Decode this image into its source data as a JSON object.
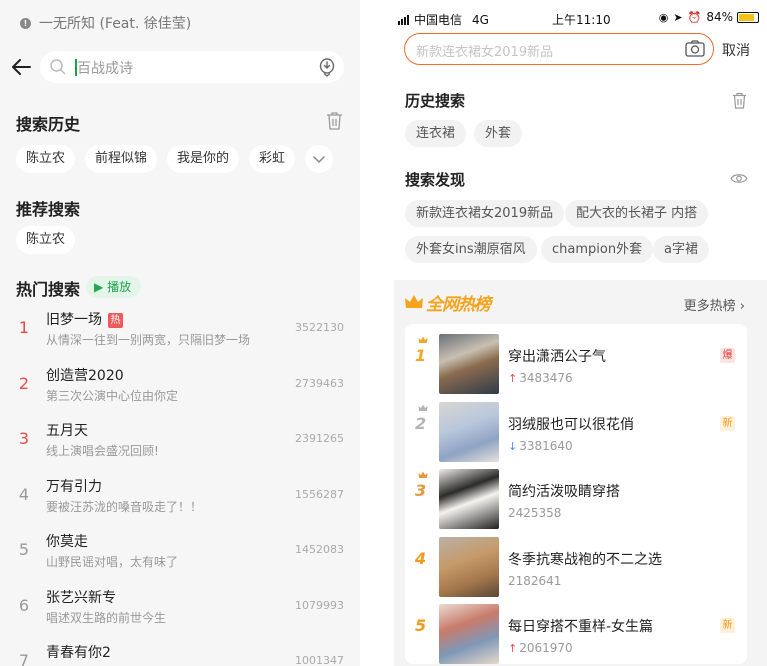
{
  "left": {
    "now_playing": "一无所知 (Feat. 徐佳莹)",
    "search_placeholder": "百战成诗",
    "history": {
      "title": "搜索历史",
      "items": [
        "陈立农",
        "前程似锦",
        "我是你的",
        "彩虹"
      ]
    },
    "recommend": {
      "title": "推荐搜索",
      "items": [
        "陈立农"
      ]
    },
    "hot": {
      "title": "热门搜索",
      "play_label": "播放",
      "items": [
        {
          "rank": "1",
          "title": "旧梦一场",
          "hot": true,
          "hot_label": "热",
          "desc": "从情深一往到一别两宽，只隔旧梦一场",
          "count": "3522130"
        },
        {
          "rank": "2",
          "title": "创造营2020",
          "hot": false,
          "desc": "第三次公演中心位由你定",
          "count": "2739463"
        },
        {
          "rank": "3",
          "title": "五月天",
          "hot": false,
          "desc": "线上演唱会盛况回顾!",
          "count": "2391265"
        },
        {
          "rank": "4",
          "title": "万有引力",
          "hot": false,
          "desc": "要被汪苏泷的嗓音吸走了！！",
          "count": "1556287"
        },
        {
          "rank": "5",
          "title": "你莫走",
          "hot": false,
          "desc": "山野民谣对唱，太有味了",
          "count": "1452083"
        },
        {
          "rank": "6",
          "title": "张艺兴新专",
          "hot": false,
          "desc": "唱述双生路的前世今生",
          "count": "1079993"
        },
        {
          "rank": "7",
          "title": "青春有你2",
          "hot": false,
          "desc": "",
          "count": "1001347"
        }
      ]
    },
    "colors": {
      "rank_top": "#e84a4a",
      "rank_other": "#999999",
      "accent_green": "#22a552"
    }
  },
  "right": {
    "status": {
      "carrier": "中国电信",
      "network": "4G",
      "time": "上午11:10",
      "battery": "84%"
    },
    "search_placeholder": "新款连衣裙女2019新品",
    "cancel": "取消",
    "history": {
      "title": "历史搜索",
      "items": [
        "连衣裙",
        "外套"
      ]
    },
    "discover": {
      "title": "搜索发现",
      "items": [
        "新款连衣裙女2019新品",
        "配大衣的长裙子 内搭",
        "外套女ins潮原宿风",
        "champion外套",
        "a字裙"
      ]
    },
    "ranking": {
      "title": "全网热榜",
      "more": "更多热榜",
      "items": [
        {
          "rank": "1",
          "title": "穿出潇洒公子气",
          "trend": "up",
          "trend_glyph": "↑",
          "count": "3483476",
          "tag": "爆"
        },
        {
          "rank": "2",
          "title": "羽绒服也可以很花俏",
          "trend": "down",
          "trend_glyph": "↓",
          "count": "3381640",
          "tag": "新"
        },
        {
          "rank": "3",
          "title": "简约活泼吸睛穿搭",
          "trend": "none",
          "trend_glyph": "",
          "count": "2425358",
          "tag": ""
        },
        {
          "rank": "4",
          "title": "冬季抗寒战袍的不二之选",
          "trend": "none",
          "trend_glyph": "",
          "count": "2182641",
          "tag": ""
        },
        {
          "rank": "5",
          "title": "每日穿搭不重样-女生篇",
          "trend": "up",
          "trend_glyph": "↑",
          "count": "2061970",
          "tag": "新"
        }
      ]
    },
    "colors": {
      "accent_orange": "#f36a25",
      "ranking_gold": "#f7a21b"
    }
  }
}
